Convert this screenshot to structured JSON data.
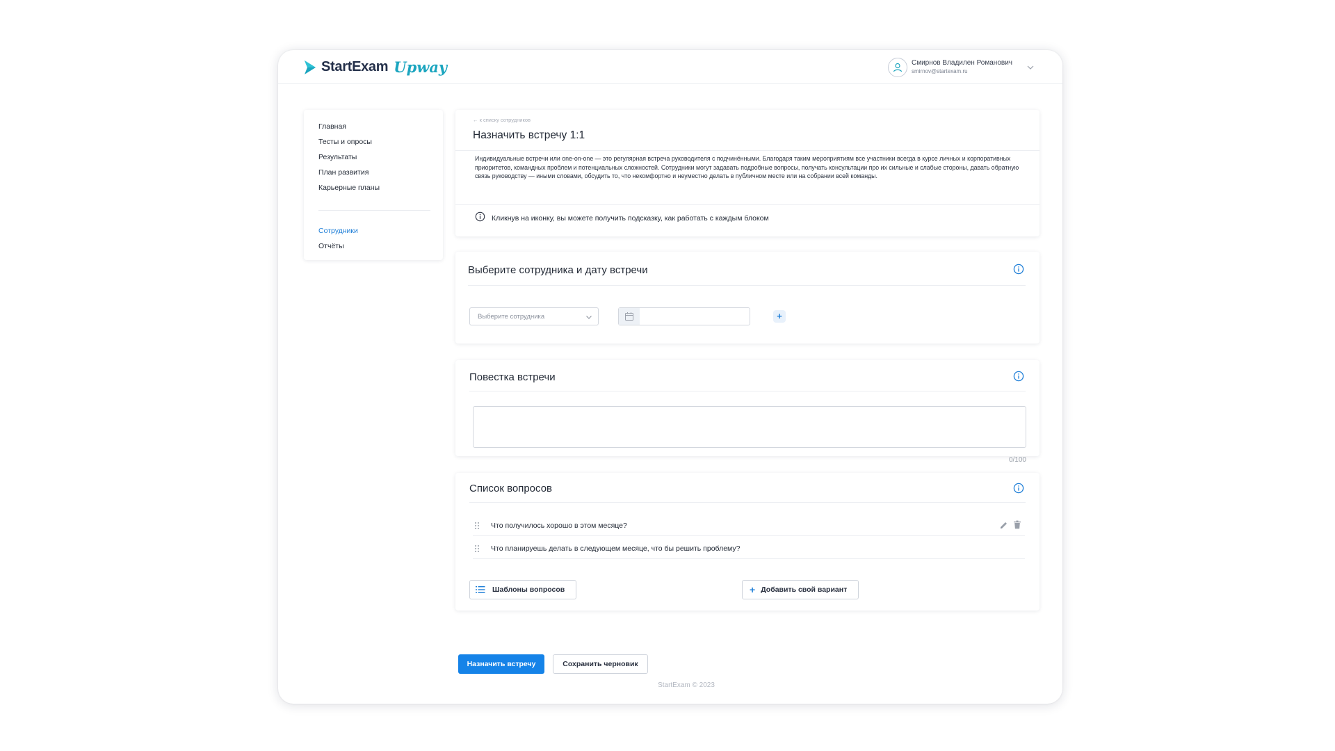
{
  "header": {
    "logo_text": "StartExam",
    "logo_sub": "Upway",
    "user_name": "Смирнов Владилен Романович",
    "user_email": "smirnov@startexam.ru"
  },
  "sidebar": {
    "items": [
      {
        "label": "Главная"
      },
      {
        "label": "Тесты и опросы"
      },
      {
        "label": "Результаты"
      },
      {
        "label": "План развития"
      },
      {
        "label": "Карьерные планы"
      },
      {
        "label": "Сотрудники"
      },
      {
        "label": "Отчёты"
      }
    ],
    "active": "Сотрудники"
  },
  "intro": {
    "back_link": "← к списку сотрудников",
    "title": "Назначить встречу 1:1",
    "description": "Индивидуальные встречи или one-on-one — это регулярная встреча руководителя с подчинёнными. Благодаря таким мероприятиям все участники всегда в курсе личных и корпоративных приоритетов, командных проблем и потенциальных сложностей. Сотрудники могут задавать подробные вопросы, получать консультации про их сильные и слабые стороны, давать обратную связь руководству — иными словами, обсудить то, что некомфортно и неуместно делать в публичном месте или на собрании всей команды.",
    "hint": "Кликнув на иконку, вы можете получить подсказку, как работать с каждым блоком"
  },
  "employee_section": {
    "title": "Выберите сотрудника и дату встречи",
    "select_placeholder": "Выберите сотрудника",
    "add_symbol": "+"
  },
  "agenda": {
    "title": "Повестка встречи",
    "counter": "0/100"
  },
  "questions": {
    "title": "Список вопросов",
    "items": [
      {
        "text": "Что получилось хорошо в этом месяце?"
      },
      {
        "text": "Что планируешь делать в следующем месяце, что бы решить проблему?"
      }
    ],
    "templates_label": "Шаблоны вопросов",
    "add_label": "Добавить свой вариант"
  },
  "actions": {
    "primary": "Назначить встречу",
    "secondary": "Сохранить черновик"
  },
  "footer": "StartExam © 2023",
  "colors": {
    "accent": "#1583e8",
    "brand": "#1ba5bf",
    "active_nav": "#1e7ed7"
  }
}
